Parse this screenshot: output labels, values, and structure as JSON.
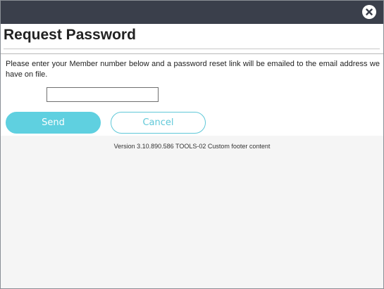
{
  "dialog": {
    "close_icon": "close-circle-icon",
    "title": "Request Password",
    "instructions": "Please enter your Member number below and a password reset link will be emailed to the email address we have on file.",
    "member_number": {
      "value": "",
      "placeholder": ""
    },
    "send_label": "Send",
    "cancel_label": "Cancel"
  },
  "footer": {
    "text": "Version 3.10.890.586 TOOLS-02 Custom footer content"
  },
  "colors": {
    "titlebar": "#3a3f4b",
    "accent": "#5fd0e0",
    "background": "#f5f5f5"
  }
}
